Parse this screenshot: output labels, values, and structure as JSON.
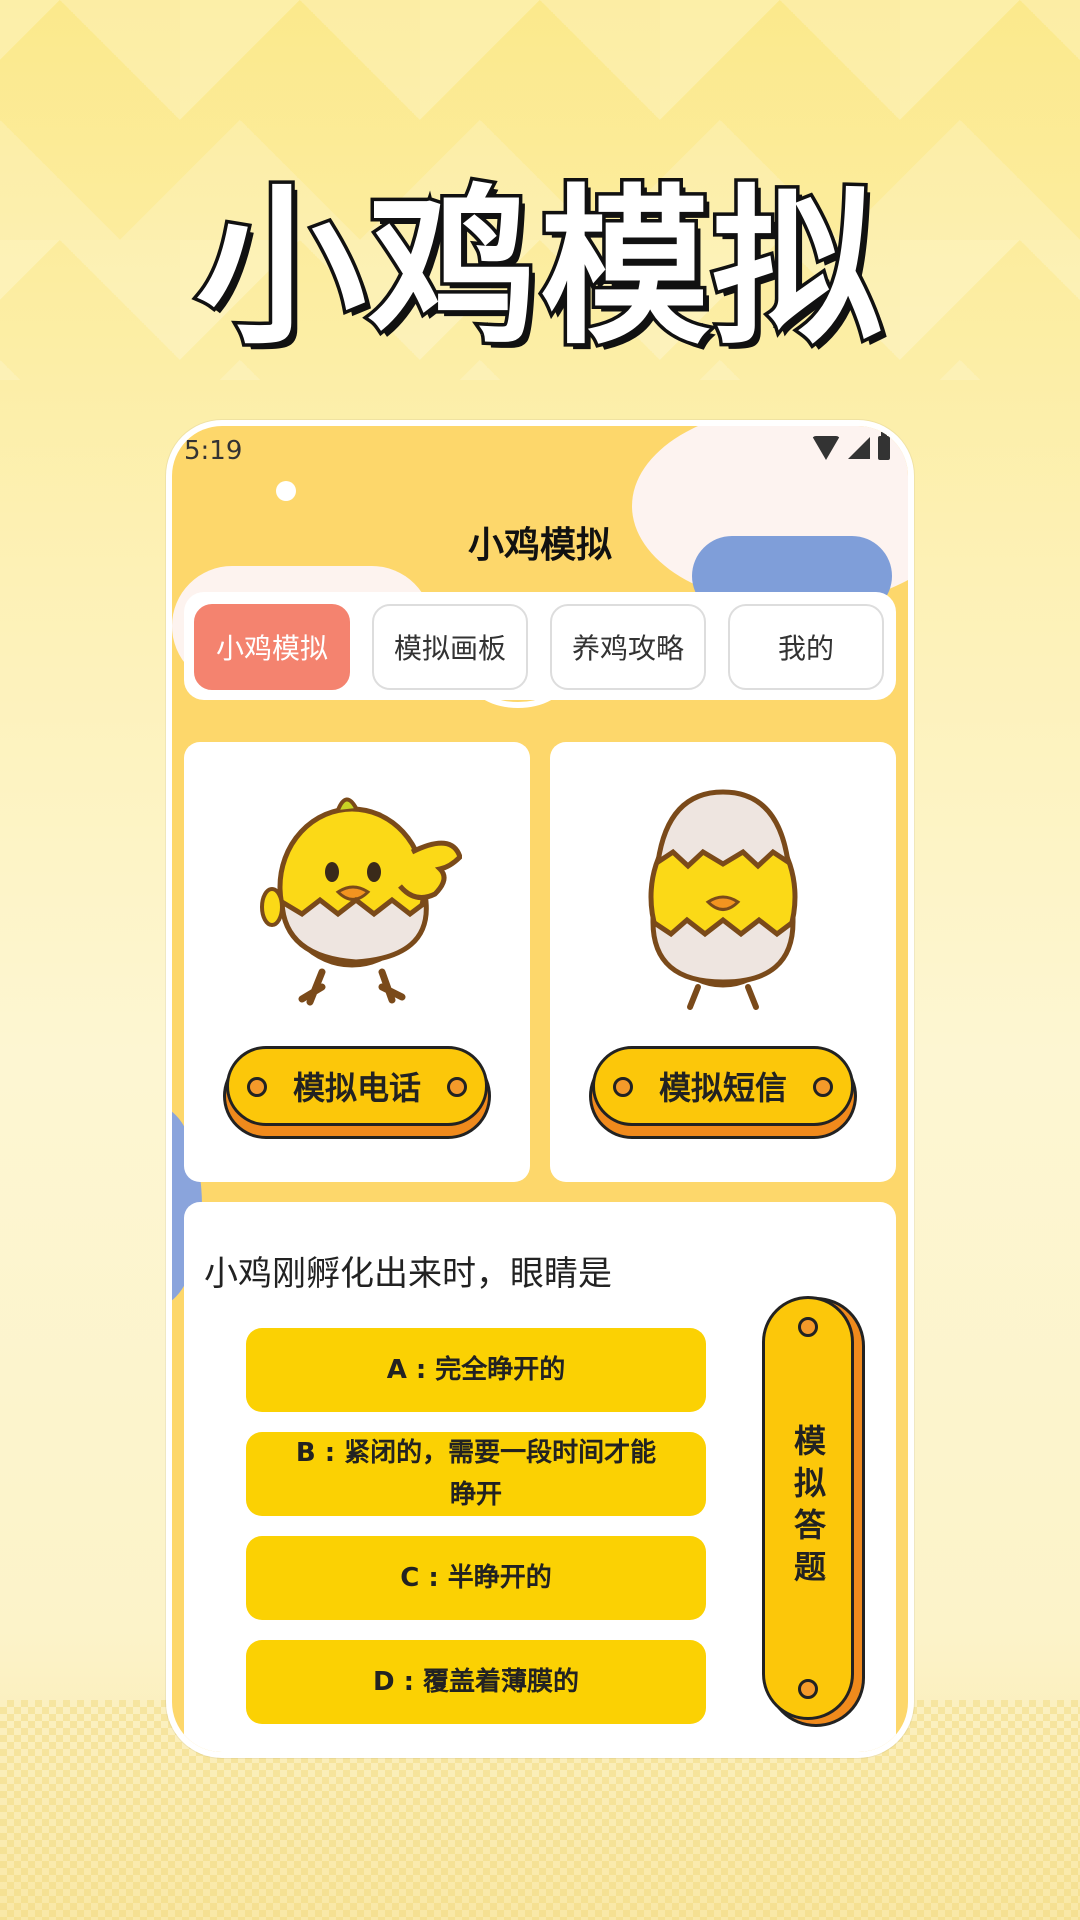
{
  "promo": {
    "title": "小鸡模拟"
  },
  "status_bar": {
    "time": "5:19"
  },
  "app": {
    "title": "小鸡模拟"
  },
  "tabs": [
    {
      "label": "小鸡模拟",
      "active": true
    },
    {
      "label": "模拟画板",
      "active": false
    },
    {
      "label": "养鸡攻略",
      "active": false
    },
    {
      "label": "我的",
      "active": false
    }
  ],
  "feature_cards": [
    {
      "button_label": "模拟电话",
      "image": "waving-chick-in-egg"
    },
    {
      "button_label": "模拟短信",
      "image": "chick-in-eggshell-hat"
    }
  ],
  "quiz": {
    "question": "小鸡刚孵化出来时，眼睛是",
    "options": [
      "A : 完全睁开的",
      "B : 紧闭的，需要一段时间才能睁开",
      "C : 半睁开的",
      "D : 覆盖着薄膜的"
    ],
    "action_label": "模拟答题"
  },
  "colors": {
    "accent_tab": "#f4836f",
    "button_yellow": "#fcc70a",
    "option_yellow": "#fbd103",
    "screen_bg": "#fdd76b"
  }
}
